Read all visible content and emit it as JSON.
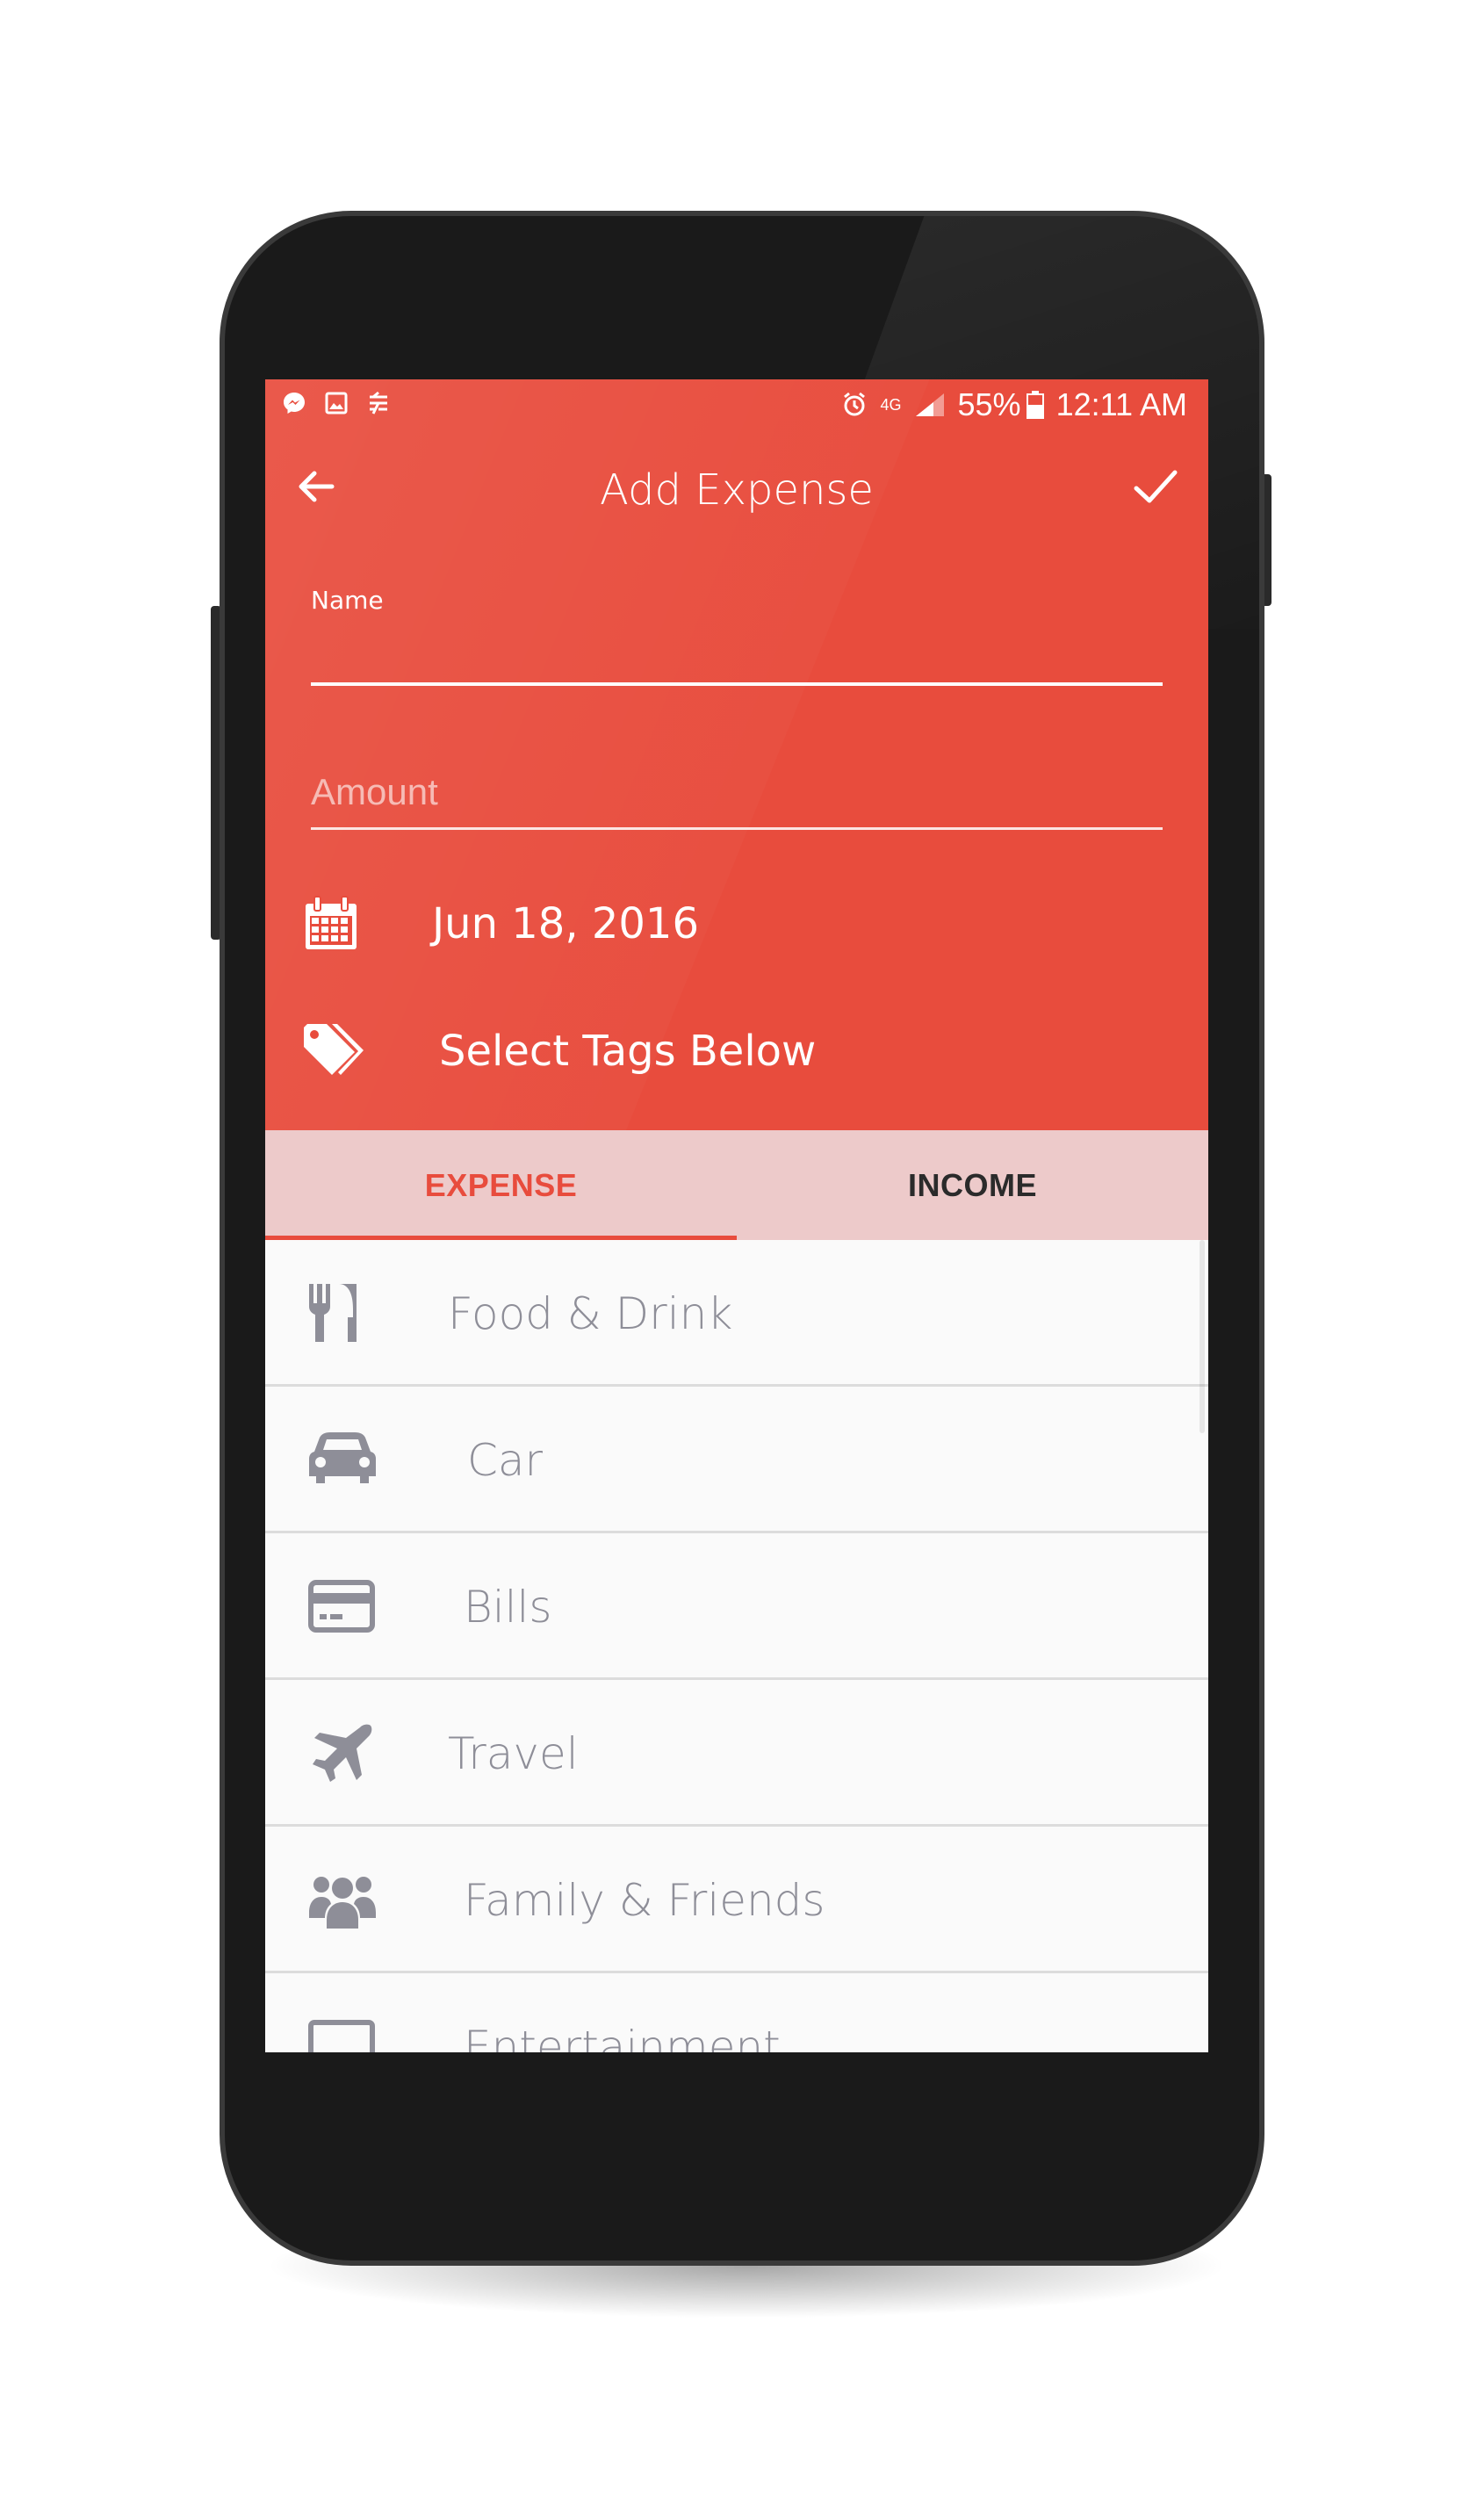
{
  "status_bar": {
    "battery": "55%",
    "time": "12:11 AM",
    "network": "4G"
  },
  "app_bar": {
    "title": "Add Expense"
  },
  "form": {
    "name_label": "Name",
    "name_value": "",
    "amount_placeholder": "Amount",
    "date": "Jun 18, 2016",
    "tags_prompt": "Select Tags Below"
  },
  "tabs": [
    {
      "label": "EXPENSE",
      "selected": true
    },
    {
      "label": "INCOME",
      "selected": false
    }
  ],
  "categories": [
    {
      "label": "Food & Drink",
      "icon": "utensils-icon"
    },
    {
      "label": "Car",
      "icon": "car-icon"
    },
    {
      "label": "Bills",
      "icon": "credit-card-icon"
    },
    {
      "label": "Travel",
      "icon": "plane-icon"
    },
    {
      "label": "Family & Friends",
      "icon": "group-icon"
    },
    {
      "label": "Entertainment",
      "icon": "tv-icon"
    }
  ],
  "colors": {
    "accent": "#e84c3d",
    "tab_bar": "#edcaca",
    "item_text": "#8e8e98"
  }
}
